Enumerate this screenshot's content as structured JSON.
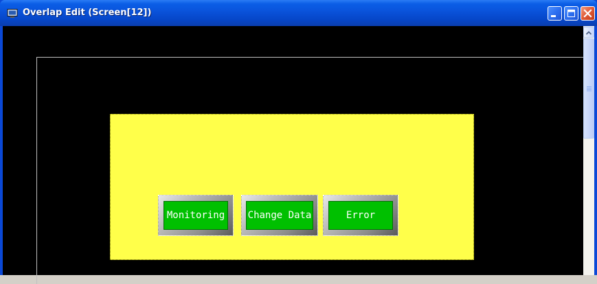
{
  "window": {
    "title": "Overlap Edit (Screen[12])",
    "title_icon": "monitor-icon",
    "controls": [
      "minimize-icon",
      "maximize-icon",
      "close-icon"
    ]
  },
  "canvas": {
    "background_color": "#000000",
    "panel_color": "#ffff4a",
    "buttons": [
      {
        "label": "Monitoring",
        "color": "#00c000"
      },
      {
        "label": "Change Data",
        "color": "#00c000"
      },
      {
        "label": "Error",
        "color": "#00c000"
      }
    ]
  },
  "scrollbar": {
    "up_icon": "scroll-up-arrow-icon"
  }
}
